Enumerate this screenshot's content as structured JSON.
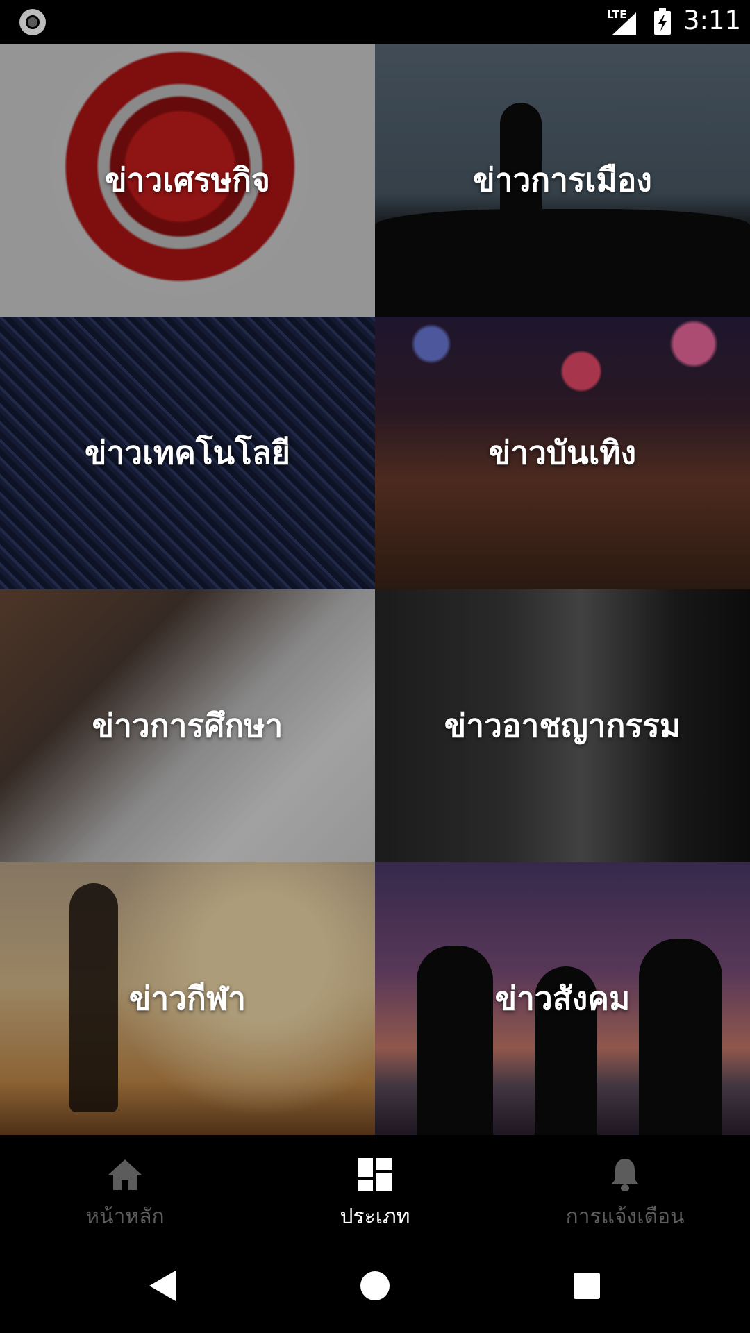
{
  "status_bar": {
    "network": "LTE",
    "time": "3:11",
    "icons": [
      "record-icon",
      "signal-icon",
      "battery-charging-icon"
    ]
  },
  "categories": [
    {
      "label": "ข่าวเศรษกิจ",
      "icon": "globe-image"
    },
    {
      "label": "ข่าวการเมือง",
      "icon": "crowd-speaker-image"
    },
    {
      "label": "ข่าวเทคโนโลยี",
      "icon": "circuit-board-image"
    },
    {
      "label": "ข่าวบันเทิง",
      "icon": "concert-crowd-image"
    },
    {
      "label": "ข่าวการศึกษา",
      "icon": "writing-hand-image"
    },
    {
      "label": "ข่าวอาชญากรรม",
      "icon": "handcuffs-image"
    },
    {
      "label": "ข่าวกีฬา",
      "icon": "runner-image"
    },
    {
      "label": "ข่าวสังคม",
      "icon": "people-holding-hands-image"
    }
  ],
  "bottom_nav": {
    "items": [
      {
        "label": "หน้าหลัก",
        "icon": "home-icon",
        "active": false
      },
      {
        "label": "ประเภท",
        "icon": "dashboard-icon",
        "active": true
      },
      {
        "label": "การแจ้งเตือน",
        "icon": "bell-icon",
        "active": false
      }
    ]
  },
  "system_nav": {
    "buttons": [
      "back-icon",
      "home-circle-icon",
      "recents-square-icon"
    ]
  },
  "colors": {
    "background": "#000000",
    "nav_inactive": "#5c5c5c",
    "nav_active": "#ffffff"
  }
}
